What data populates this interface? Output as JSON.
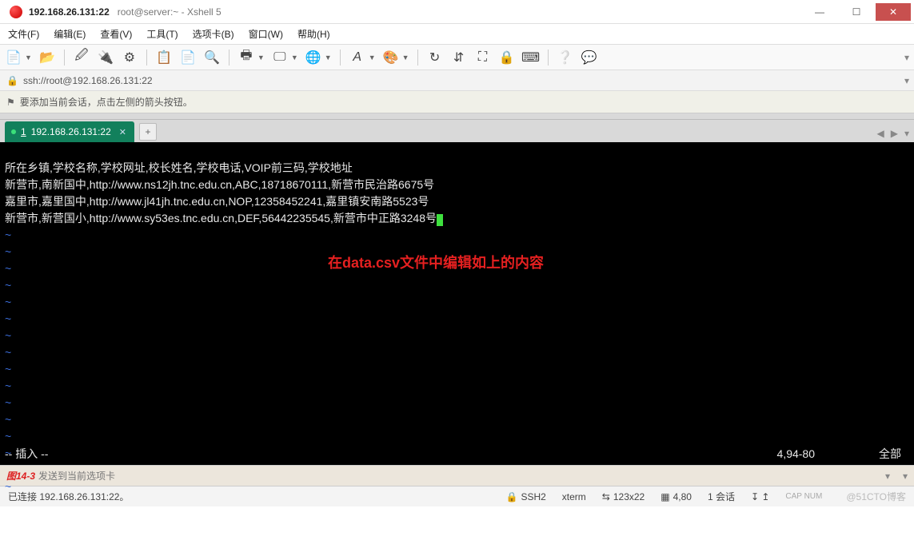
{
  "title": {
    "address": "192.168.26.131:22",
    "label": "root@server:~ - Xshell 5"
  },
  "menu": {
    "file": "文件(F)",
    "edit": "编辑(E)",
    "view": "查看(V)",
    "tools": "工具(T)",
    "tabs": "选项卡(B)",
    "window": "窗口(W)",
    "help": "帮助(H)"
  },
  "addressbar": {
    "url": "ssh://root@192.168.26.131:22"
  },
  "hint": {
    "text": "要添加当前会话，点击左侧的箭头按钮。"
  },
  "tab": {
    "num": "1",
    "label": "192.168.26.131:22",
    "add": "+"
  },
  "terminal": {
    "lines": [
      "所在乡镇,学校名称,学校网址,校长姓名,学校电话,VOIP前三码,学校地址",
      "新营市,南新国中,http://www.ns12jh.tnc.edu.cn,ABC,18718670111,新营市民治路6675号",
      "嘉里市,嘉里国中,http://www.jl41jh.tnc.edu.cn,NOP,12358452241,嘉里镇安南路5523号",
      "新营市,新营国小,http://www.sy53es.tnc.edu.cn,DEF,56442235545,新营市中正路3248号"
    ],
    "annotation": "在data.csv文件中编辑如上的内容",
    "mode": "-- 插入 --",
    "position": "4,94-80",
    "extent": "全部"
  },
  "sendbar": {
    "figure": "图14-3",
    "placeholder": "发送到当前选项卡"
  },
  "status": {
    "left": "已连接 192.168.26.131:22。",
    "proto": "SSH2",
    "term": "xterm",
    "size": "123x22",
    "cursor": "4,80",
    "sessions": "1 会话",
    "cap": "CAP  NUM",
    "watermark": "@51CTO博客"
  },
  "icons": {
    "lock": "🔒",
    "flag": "⚑",
    "ssh": "🔒",
    "arrows": "⇆",
    "grid": "▦",
    "min": "—",
    "max": "☐",
    "close": "✕",
    "plus": "+",
    "left": "◀",
    "right": "▶",
    "down": "▾"
  }
}
